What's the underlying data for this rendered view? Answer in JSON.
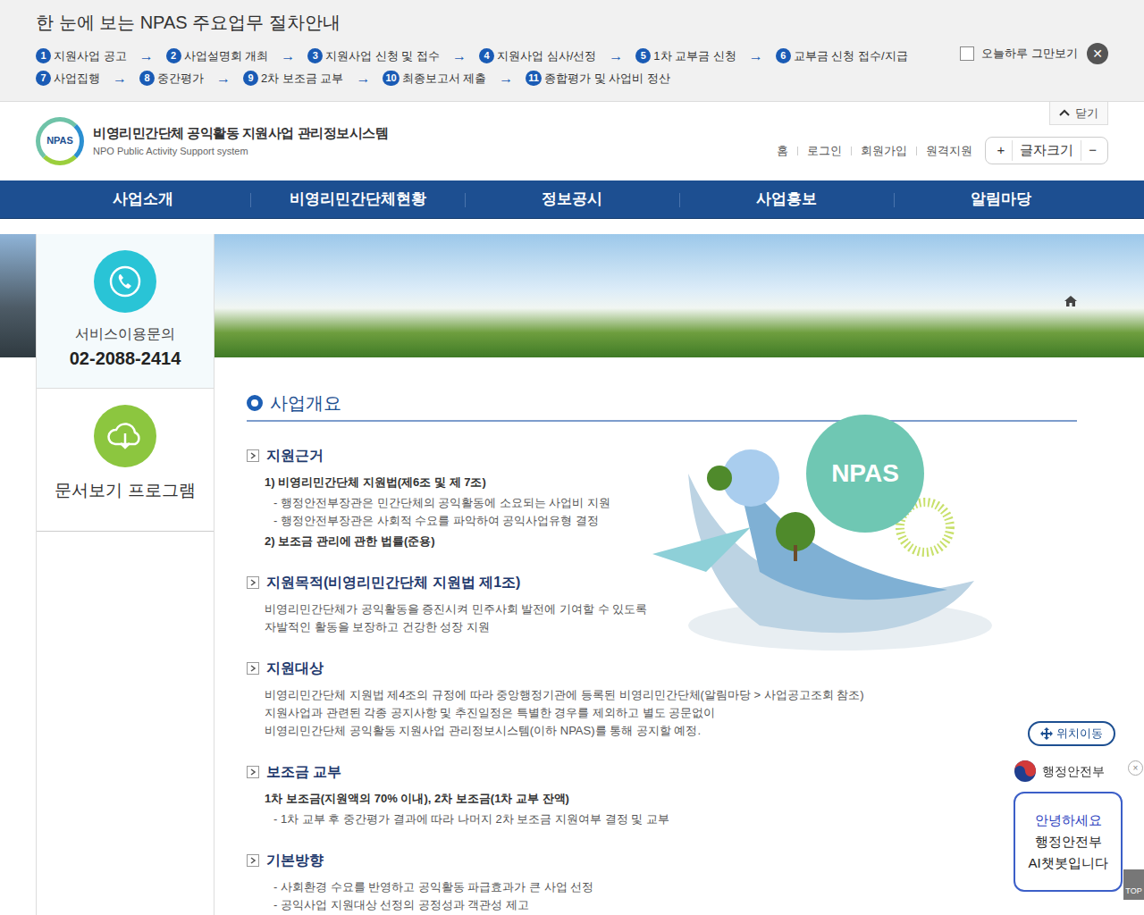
{
  "notice": {
    "title": "한 눈에 보는 NPAS 주요업무 절차안내",
    "arrow": "→",
    "step_rows": [
      [
        {
          "num": "1",
          "label": "지원사업 공고"
        },
        {
          "num": "2",
          "label": "사업설명회 개최"
        },
        {
          "num": "3",
          "label": "지원사업 신청 및 접수"
        },
        {
          "num": "4",
          "label": "지원사업 심사/선정"
        },
        {
          "num": "5",
          "label": "1차 교부금 신청"
        },
        {
          "num": "6",
          "label": "교부금 신청 접수/지급"
        }
      ],
      [
        {
          "num": "7",
          "label": "사업집행"
        },
        {
          "num": "8",
          "label": "중간평가"
        },
        {
          "num": "9",
          "label": "2차 보조금 교부"
        },
        {
          "num": "10",
          "label": "최종보고서 제출"
        },
        {
          "num": "11",
          "label": "종합평가 및 사업비 정산"
        }
      ]
    ],
    "dismiss": {
      "label": "오늘하루 그만보기",
      "checked": false
    },
    "close": "✕",
    "collapse": "닫기"
  },
  "header": {
    "logo_mark": "NPAS",
    "title": "비영리민간단체 공익활동 지원사업 관리정보시스템",
    "subtitle": "NPO Public Activity Support system",
    "util_links": [
      "홈",
      "로그인",
      "회원가입",
      "원격지원"
    ],
    "font_size": {
      "plus": "+",
      "label": "글자크기",
      "minus": "−"
    }
  },
  "nav": [
    "사업소개",
    "비영리민간단체현황",
    "정보공시",
    "사업홍보",
    "알림마당"
  ],
  "sidebar": [
    {
      "label": "서비스이용문의",
      "value": "02-2088-2414"
    },
    {
      "label": "문서보기 프로그램",
      "value": ""
    }
  ],
  "content": {
    "heading": "사업개요",
    "sections": [
      {
        "title": "지원근거",
        "lines": [
          {
            "kind": "bold",
            "text": "1) 비영리민간단체 지원법(제6조 및 제 7조)"
          },
          {
            "kind": "dash",
            "text": "- 행정안전부장관은 민간단체의 공익활동에 소요되는 사업비 지원"
          },
          {
            "kind": "dash",
            "text": "- 행정안전부장관은 사회적 수요를 파악하여 공익사업유형 결정"
          },
          {
            "kind": "bold",
            "text": "2) 보조금 관리에 관한 법률(준용)"
          }
        ]
      },
      {
        "title": "지원목적(비영리민간단체 지원법 제1조)",
        "lines": [
          {
            "kind": "plain",
            "text": "비영리민간단체가 공익활동을 증진시켜 민주사회 발전에 기여할 수 있도록"
          },
          {
            "kind": "plain",
            "text": "자발적인 활동을 보장하고 건강한 성장 지원"
          }
        ]
      },
      {
        "title": "지원대상",
        "lines": [
          {
            "kind": "plain",
            "text": "비영리민간단체 지원법 제4조의 규정에 따라 중앙행정기관에 등록된 비영리민간단체(알림마당 > 사업공고조회 참조)"
          },
          {
            "kind": "plain",
            "text": "지원사업과 관련된 각종 공지사항 및 추진일정은 특별한 경우를 제외하고 별도 공문없이"
          },
          {
            "kind": "plain",
            "text": "비영리민간단체 공익활동 지원사업 관리정보시스템(이하 NPAS)를 통해 공지할 예정."
          }
        ]
      },
      {
        "title": "보조금 교부",
        "lines": [
          {
            "kind": "bold",
            "text": "1차 보조금(지원액의 70% 이내), 2차 보조금(1차 교부 잔액)"
          },
          {
            "kind": "dash",
            "text": "- 1차 교부 후 중간평가 결과에 따라 나머지 2차 보조금 지원여부 결정 및 교부"
          }
        ]
      },
      {
        "title": "기본방향",
        "lines": [
          {
            "kind": "dash",
            "text": "- 사회환경 수요를 반영하고 공익활동 파급효과가 큰 사업 선정"
          },
          {
            "kind": "dash",
            "text": "- 공익사업 지원대상 선정의 공정성과 객관성 제고"
          }
        ]
      }
    ],
    "illustration": "NPAS"
  },
  "floating": {
    "move": "위치이동",
    "ministry": "행정안전부",
    "close": "×",
    "chat": [
      "안녕하세요",
      "행정안전부",
      "AI챗봇입니다"
    ],
    "top": "TOP"
  }
}
